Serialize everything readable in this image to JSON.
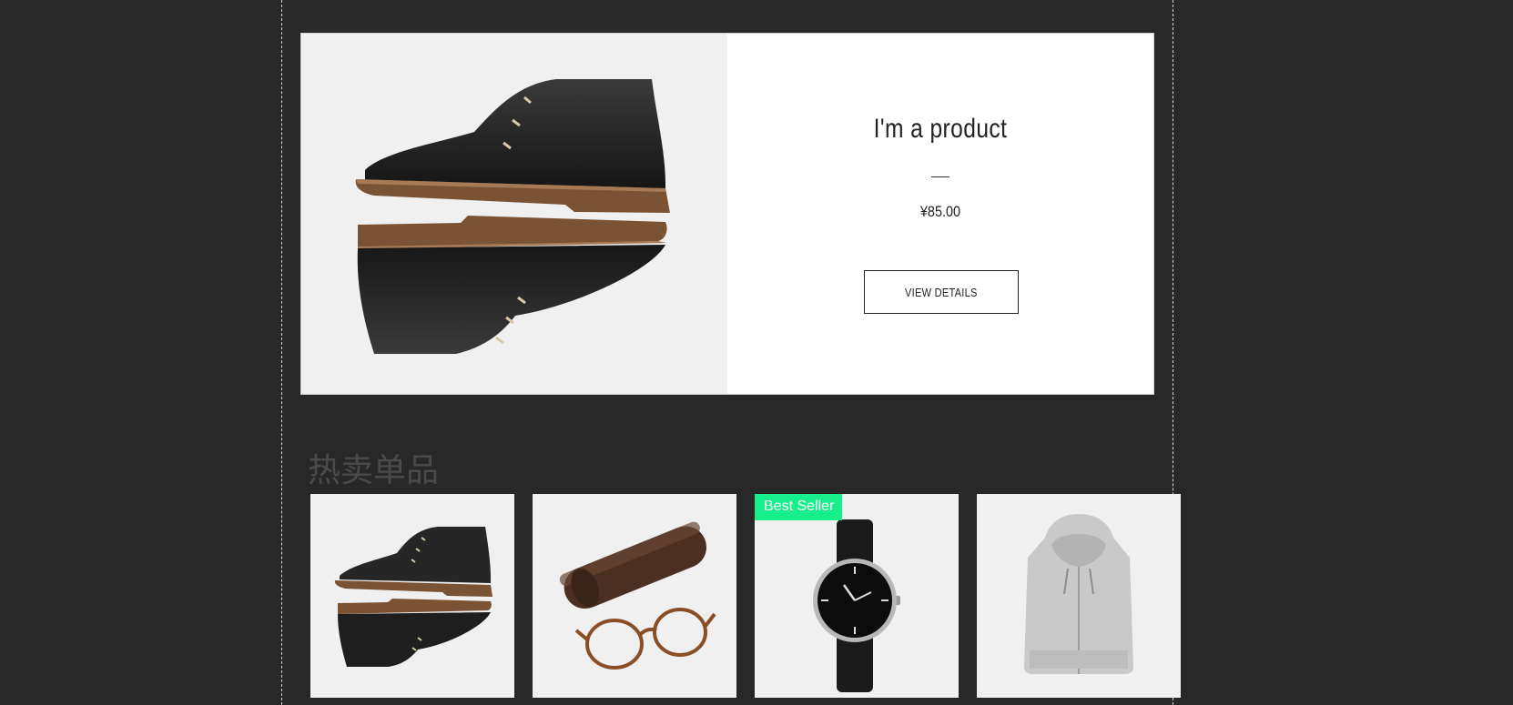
{
  "featured": {
    "title": "I'm a product",
    "price": "¥85.00",
    "button_label": "VIEW DETAILS",
    "image_icon": "shoes-image"
  },
  "section": {
    "heading": "热卖单品"
  },
  "products": [
    {
      "image_icon": "shoes-image",
      "badge": ""
    },
    {
      "image_icon": "glasses-case-image",
      "badge": ""
    },
    {
      "image_icon": "watch-image",
      "badge": "Best Seller"
    },
    {
      "image_icon": "hoodie-image",
      "badge": ""
    }
  ],
  "colors": {
    "page_background": "#282828",
    "badge": "#17f08a"
  }
}
